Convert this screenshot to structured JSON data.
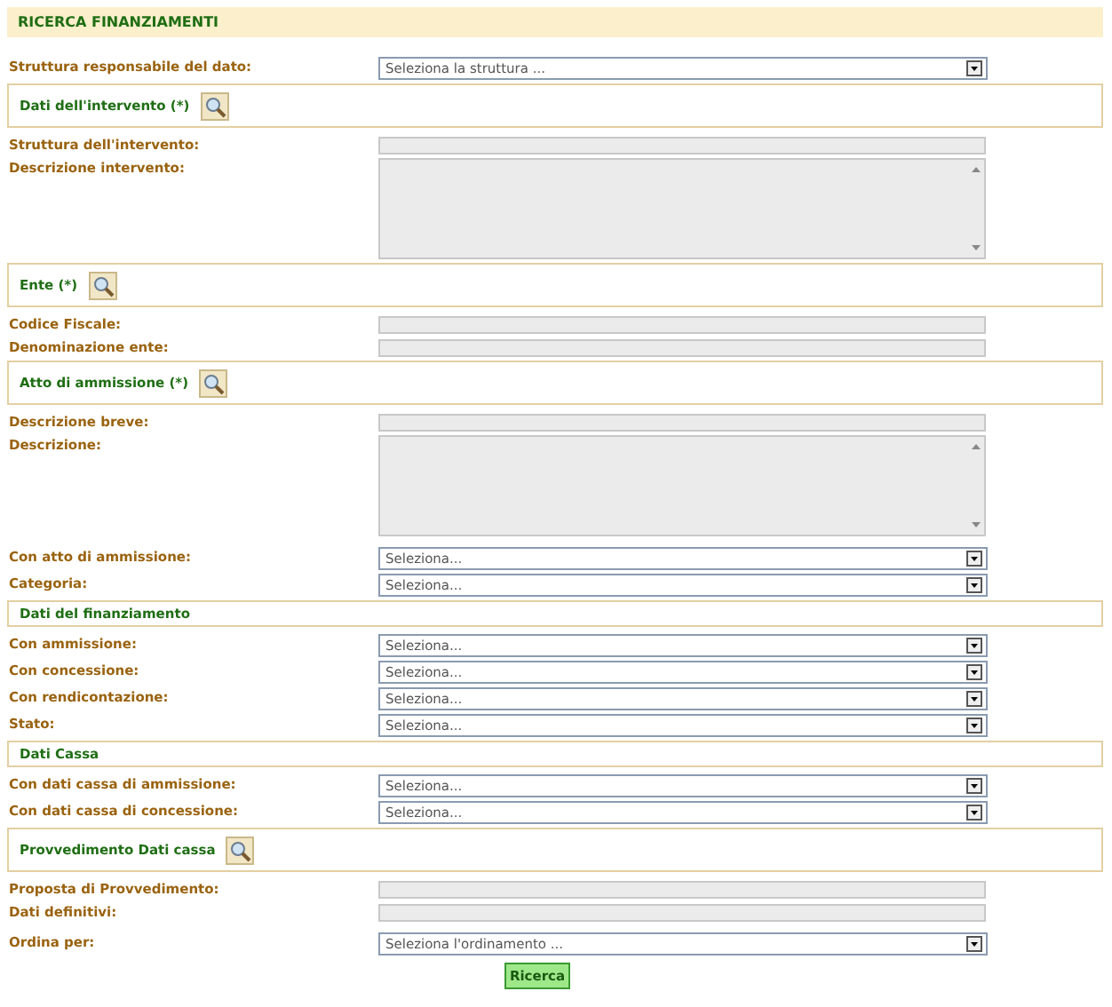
{
  "title": "RICERCA FINANZIAMENTI",
  "rows": [
    {
      "kind": "select",
      "label": "Struttura responsabile del dato:",
      "value": "Seleziona la struttura ..."
    },
    {
      "kind": "section",
      "label": "Dati dell'intervento (*)",
      "lookup": true
    },
    {
      "kind": "input",
      "label": "Struttura dell'intervento:",
      "disabled": true
    },
    {
      "kind": "textarea",
      "label": "Descrizione intervento:",
      "disabled": true
    },
    {
      "kind": "section",
      "label": "Ente (*)",
      "lookup": true
    },
    {
      "kind": "input",
      "label": "Codice Fiscale:",
      "disabled": true
    },
    {
      "kind": "input",
      "label": "Denominazione ente:",
      "disabled": true
    },
    {
      "kind": "section",
      "label": "Atto di ammissione (*)",
      "lookup": true
    },
    {
      "kind": "input",
      "label": "Descrizione breve:",
      "disabled": true
    },
    {
      "kind": "textarea",
      "label": "Descrizione:",
      "disabled": true
    },
    {
      "kind": "select",
      "label": "Con atto di ammissione:",
      "value": "Seleziona..."
    },
    {
      "kind": "select",
      "label": "Categoria:",
      "value": "Seleziona..."
    },
    {
      "kind": "section",
      "label": "Dati del finanziamento",
      "lookup": false
    },
    {
      "kind": "select",
      "label": "Con ammissione:",
      "value": "Seleziona..."
    },
    {
      "kind": "select",
      "label": "Con concessione:",
      "value": "Seleziona..."
    },
    {
      "kind": "select",
      "label": "Con rendicontazione:",
      "value": "Seleziona..."
    },
    {
      "kind": "select",
      "label": "Stato:",
      "value": "Seleziona..."
    },
    {
      "kind": "section",
      "label": "Dati Cassa",
      "lookup": false
    },
    {
      "kind": "select",
      "label": "Con dati cassa di ammissione:",
      "value": "Seleziona..."
    },
    {
      "kind": "select",
      "label": "Con dati cassa di concessione:",
      "value": "Seleziona..."
    },
    {
      "kind": "section",
      "label": "Provvedimento Dati cassa",
      "lookup": true
    },
    {
      "kind": "input",
      "label": "Proposta di Provvedimento:",
      "disabled": true
    },
    {
      "kind": "input",
      "label": "Dati definitivi:",
      "disabled": true
    },
    {
      "kind": "select",
      "label": "Ordina per:",
      "value": "Seleziona l'ordinamento ..."
    }
  ],
  "button": "Ricerca"
}
